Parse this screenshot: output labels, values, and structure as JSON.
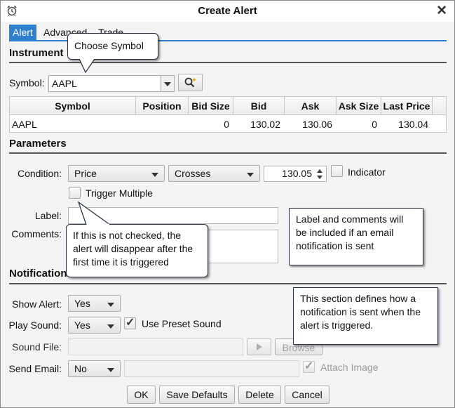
{
  "window": {
    "title": "Create Alert",
    "icon": "alarm-clock-icon",
    "close_icon": "close-icon"
  },
  "tabs": [
    {
      "label": "Alert",
      "active": true
    },
    {
      "label": "Advanced",
      "active": false
    },
    {
      "label": "Trade",
      "active": false
    }
  ],
  "instrument": {
    "heading": "Instrument",
    "symbol_label": "Symbol:",
    "symbol_value": "AAPL",
    "search_icon": "magnifier-icon",
    "table": {
      "headers": [
        "Symbol",
        "Position",
        "Bid Size",
        "Bid",
        "Ask",
        "Ask Size",
        "Last Price"
      ],
      "rows": [
        [
          "AAPL",
          "",
          "0",
          "130.02",
          "130.06",
          "0",
          "130.04"
        ]
      ]
    }
  },
  "parameters": {
    "heading": "Parameters",
    "condition_label": "Condition:",
    "condition_field": "Price",
    "condition_operator": "Crosses",
    "condition_value": "130.05",
    "indicator_label": "Indicator",
    "indicator_checked": false,
    "trigger_multiple_label": "Trigger Multiple",
    "trigger_multiple_checked": false,
    "label_label": "Label:",
    "label_value": "",
    "comments_label": "Comments:",
    "comments_value": ""
  },
  "notification": {
    "heading": "Notification",
    "show_alert_label": "Show Alert:",
    "show_alert_value": "Yes",
    "play_sound_label": "Play Sound:",
    "play_sound_value": "Yes",
    "use_preset_sound_label": "Use Preset Sound",
    "use_preset_sound_checked": true,
    "sound_file_label": "Sound File:",
    "sound_file_value": "",
    "browse_label": "Browse",
    "send_email_label": "Send Email:",
    "send_email_value": "No",
    "email_value": "",
    "attach_image_label": "Attach Image",
    "attach_image_checked": true
  },
  "buttons": {
    "ok": "OK",
    "save_defaults": "Save Defaults",
    "delete": "Delete",
    "cancel": "Cancel"
  },
  "callouts": {
    "choose_symbol": "Choose Symbol",
    "trigger_multiple_note": "If this is not checked, the alert will disappear after the first time it is triggered",
    "label_comments_note": "Label and comments will be included if an email notification is sent",
    "notification_note": "This section defines how a notification is sent when the alert is triggered."
  },
  "colors": {
    "tab_accent": "#2f7fcf",
    "callout_border": "#2a3440"
  }
}
